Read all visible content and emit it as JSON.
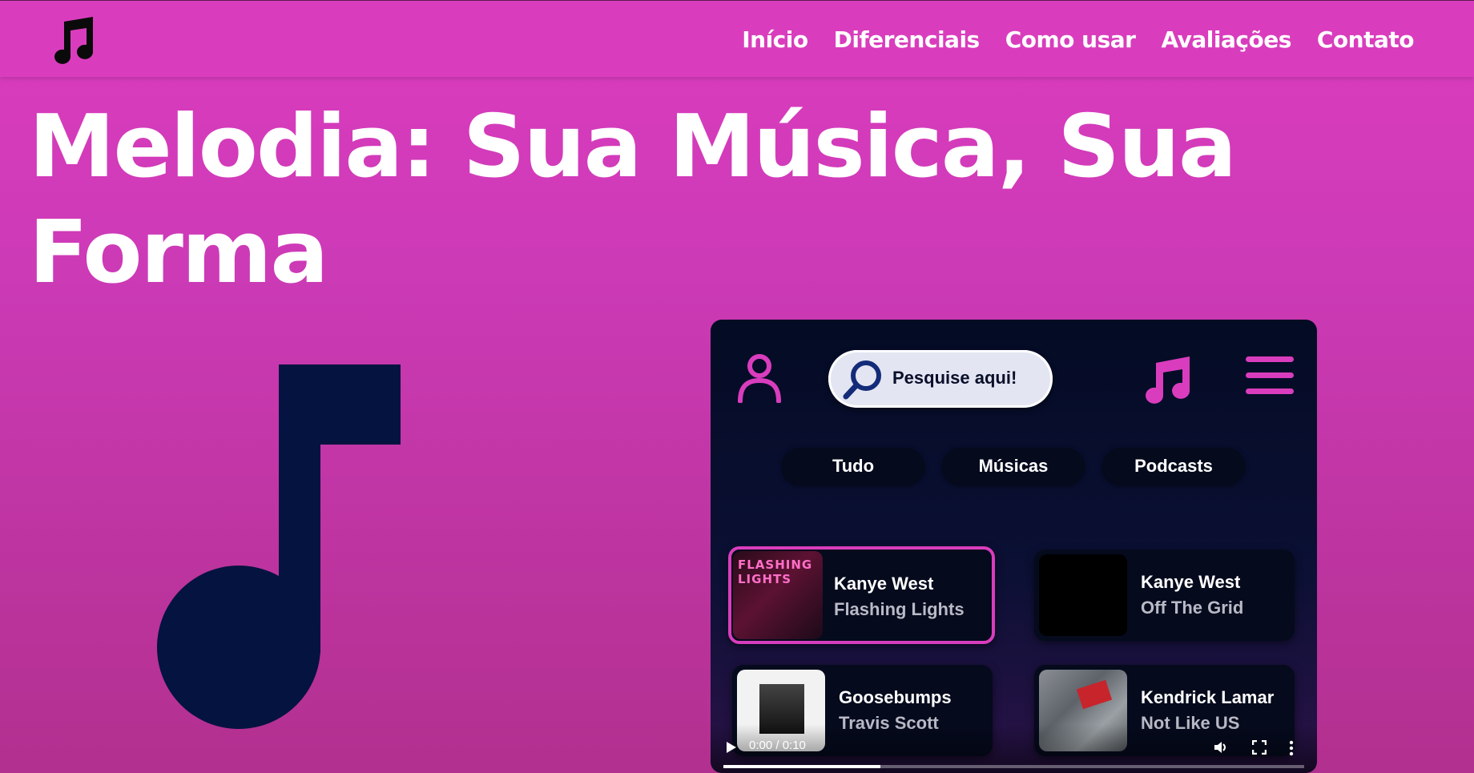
{
  "header": {
    "logo_icon": "music-note-icon",
    "nav": [
      "Início",
      "Diferenciais",
      "Como usar",
      "Avaliações",
      "Contato"
    ]
  },
  "hero": {
    "title_line1": "Melodia: Sua Música, Sua",
    "title_line2": "Forma",
    "illustration_icon": "music-note-icon"
  },
  "app_preview": {
    "user_icon": "user-icon",
    "search": {
      "placeholder": "Pesquise aqui!",
      "icon": "search-icon"
    },
    "note_icon": "music-note-icon",
    "menu_icon": "hamburger-menu-icon",
    "chips": [
      "Tudo",
      "Músicas",
      "Podcasts"
    ],
    "cards": [
      {
        "title": "Kanye West",
        "subtitle": "Flashing Lights",
        "art_text": "FLASHING LIGHTS",
        "active": true
      },
      {
        "title": "Kanye West",
        "subtitle": "Off The Grid",
        "active": false
      },
      {
        "title": "Goosebumps",
        "subtitle": "Travis Scott",
        "active": false
      },
      {
        "title": "Kendrick Lamar",
        "subtitle": "Not Like US",
        "active": false
      }
    ],
    "video": {
      "time": "0:00 / 0:10",
      "progress": 0.27
    }
  },
  "colors": {
    "accent": "#d93dbd",
    "navy": "#04133f",
    "panel": "#040b24"
  }
}
